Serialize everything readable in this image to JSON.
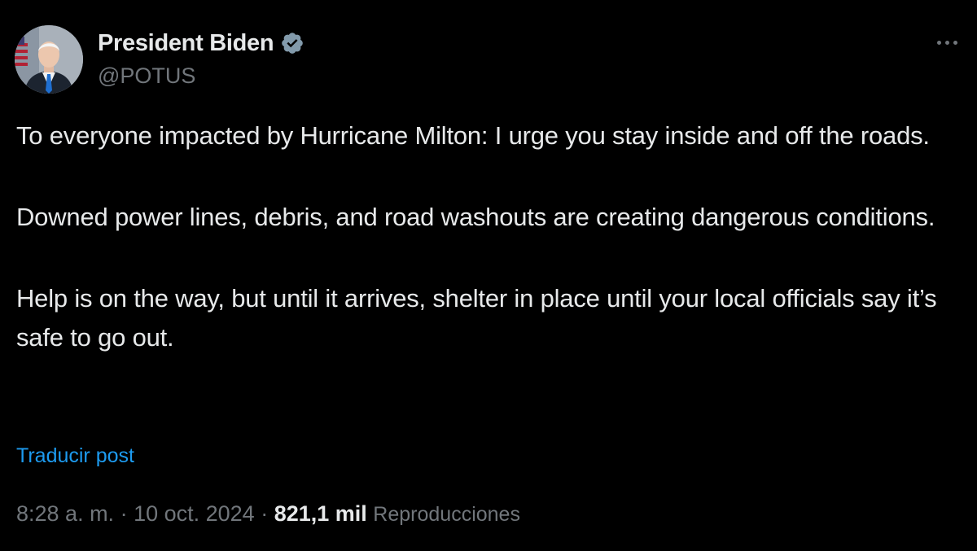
{
  "author": {
    "display_name": "President Biden",
    "handle": "@POTUS",
    "verified": true,
    "verified_color": "#71767b"
  },
  "menu": {
    "icon": "more-horizontal-icon"
  },
  "post": {
    "paragraphs": [
      "To everyone impacted by Hurricane Milton: I urge you stay inside and off the roads.",
      "Downed power lines, debris, and road washouts are creating dangerous conditions.",
      "Help is on the way, but until it arrives, shelter in place until your local officials say it’s safe to go out."
    ],
    "translate_label": "Traducir post"
  },
  "meta": {
    "time": "8:28 a. m.",
    "separator": " · ",
    "date": "10 oct. 2024",
    "views_count": "821,1 mil",
    "views_label": "Reproducciones"
  },
  "colors": {
    "background": "#000000",
    "text": "#e7e9ea",
    "secondary": "#71767b",
    "link": "#1d9bf0"
  }
}
